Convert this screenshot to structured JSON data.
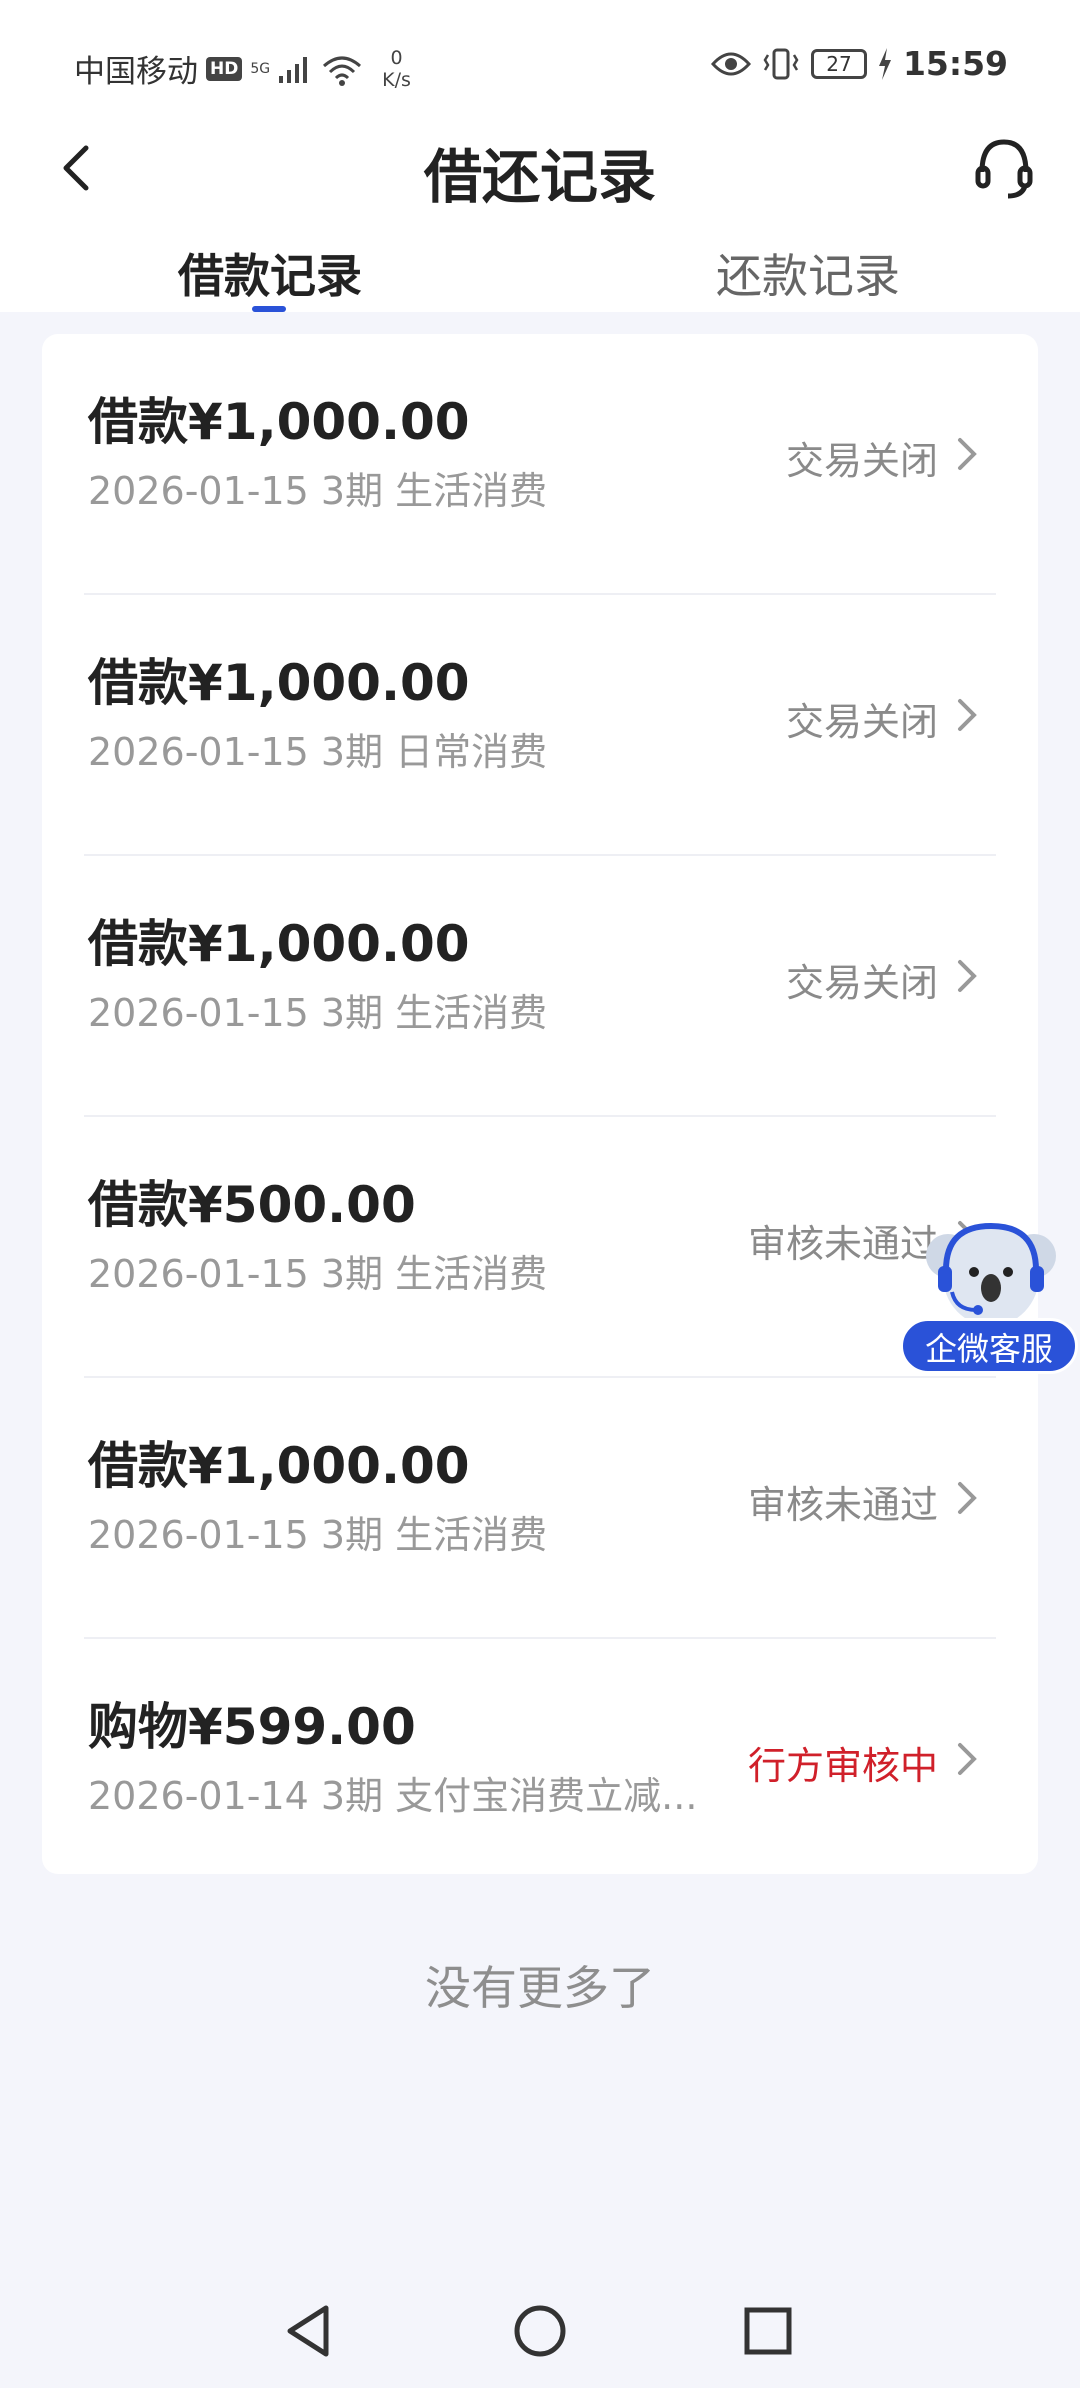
{
  "status_bar": {
    "carrier": "中国移动",
    "hd": "HD",
    "network": "5G",
    "speed_value": "0",
    "speed_unit": "K/s",
    "battery": "27",
    "time": "15:59"
  },
  "header": {
    "title": "借还记录"
  },
  "tabs": [
    {
      "label": "借款记录",
      "active": true
    },
    {
      "label": "还款记录",
      "active": false
    }
  ],
  "records": [
    {
      "title": "借款¥1,000.00",
      "subtitle": "2026-01-15 3期  生活消费",
      "status": "交易关闭",
      "status_color": "#8a8a8a"
    },
    {
      "title": "借款¥1,000.00",
      "subtitle": "2026-01-15 3期  日常消费",
      "status": "交易关闭",
      "status_color": "#8a8a8a"
    },
    {
      "title": "借款¥1,000.00",
      "subtitle": "2026-01-15 3期  生活消费",
      "status": "交易关闭",
      "status_color": "#8a8a8a"
    },
    {
      "title": "借款¥500.00",
      "subtitle": "2026-01-15 3期  生活消费",
      "status": "审核未通过",
      "status_color": "#8a8a8a"
    },
    {
      "title": "借款¥1,000.00",
      "subtitle": "2026-01-15 3期  生活消费",
      "status": "审核未通过",
      "status_color": "#8a8a8a"
    },
    {
      "title": "购物¥599.00",
      "subtitle": "2026-01-14 3期  支付宝消费立减...",
      "status": "行方审核中",
      "status_color": "#d0202a"
    }
  ],
  "footer": {
    "no_more": "没有更多了"
  },
  "float_service": {
    "label": "企微客服"
  },
  "colors": {
    "accent": "#2a52d8",
    "background": "#f4f5fb",
    "status_red": "#d0202a"
  }
}
